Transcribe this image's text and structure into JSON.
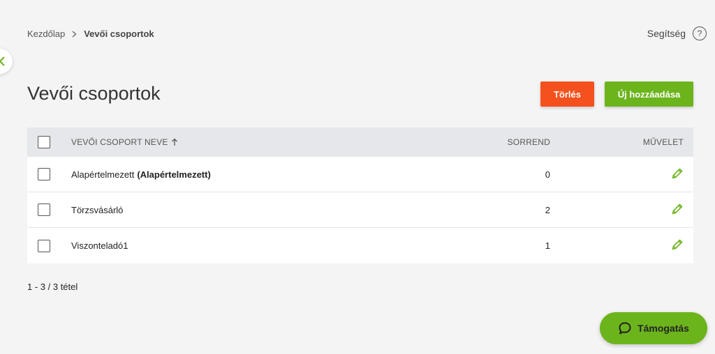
{
  "breadcrumb": {
    "home": "Kezdőlap",
    "current": "Vevői csoportok"
  },
  "help": {
    "label": "Segítség",
    "icon": "?"
  },
  "page": {
    "title": "Vevői csoportok"
  },
  "toolbar": {
    "delete_label": "Törlés",
    "add_label": "Új hozzáadása"
  },
  "table": {
    "columns": {
      "name": "VEVŐI CSOPORT NEVE",
      "order": "SORREND",
      "action": "MŰVELET"
    },
    "rows": [
      {
        "name": "Alapértelmezett",
        "tag": "(Alapértelmezett)",
        "order": "0"
      },
      {
        "name": "Törzsvásárló",
        "tag": "",
        "order": "2"
      },
      {
        "name": "Viszonteladó1",
        "tag": "",
        "order": "1"
      }
    ]
  },
  "pagination": {
    "text": "1 - 3 / 3 tétel"
  },
  "support": {
    "label": "Támogatás"
  },
  "colors": {
    "accent_green": "#6cb41c",
    "danger_orange": "#f4511e"
  }
}
